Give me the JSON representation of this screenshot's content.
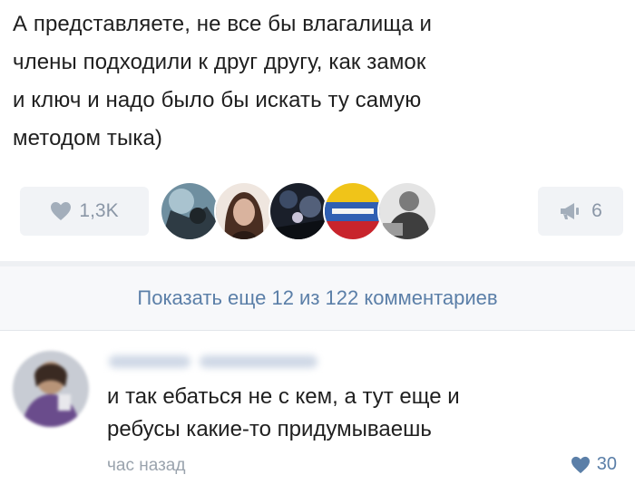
{
  "post": {
    "text": "А представляете, не все бы влагалища и\nчлены подходили к друг другу, как замок\nи ключ и надо было бы искать ту самую\nметодом тыка)"
  },
  "actions": {
    "likes_count": "1,3K",
    "reposts_count": "6",
    "like_icon": "heart-icon",
    "repost_icon": "megaphone-icon"
  },
  "show_more": {
    "label": "Показать еще 12 из 122 комментариев"
  },
  "comment": {
    "text": "и так ебаться не с кем, а тут еще и\nребусы какие-то придумываешь",
    "time": "час назад",
    "likes_count": "30"
  },
  "colors": {
    "accent": "#5b7fa8",
    "muted": "#8a96a6",
    "pill_bg": "#f1f3f6"
  }
}
